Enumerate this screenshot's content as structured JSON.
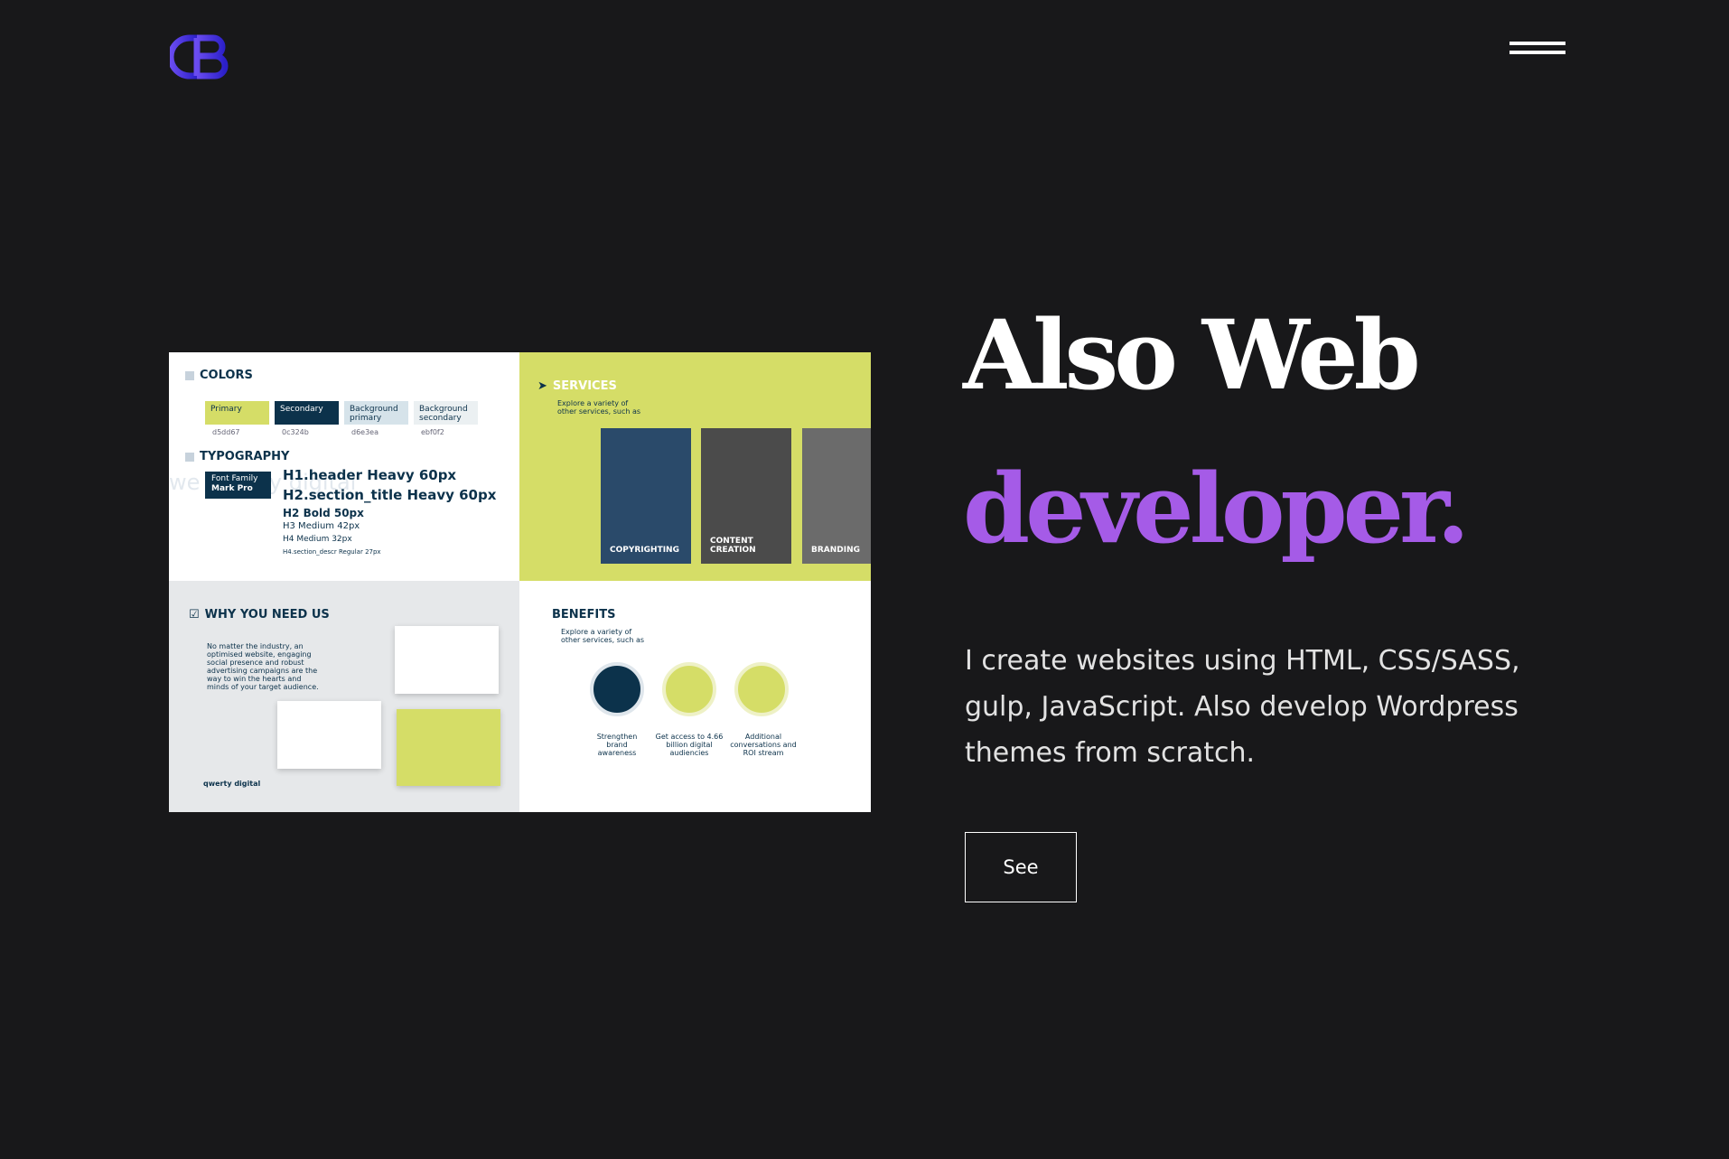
{
  "header": {
    "logo_icon": "cb-logo",
    "logo_color": "#5a3be0",
    "menu_icon": "hamburger-icon"
  },
  "hero": {
    "title_line1": "Also Web",
    "title_line2": "developer.",
    "title_line2_color": "#a55be7",
    "description": "I create websites using HTML, CSS/SASS, gulp, JavaScript. Also develop Wordpress themes from scratch.",
    "cta_label": "See"
  },
  "preview": {
    "colors": {
      "heading": "COLORS",
      "swatches": [
        {
          "label": "Primary",
          "hex": "d5dd67",
          "color": "#d5dd67"
        },
        {
          "label": "Secondary",
          "hex": "0c324b",
          "color": "#0c324b"
        },
        {
          "label": "Background primary",
          "hex": "d6e3ea",
          "color": "#d6e3ea"
        },
        {
          "label": "Background secondary",
          "hex": "ebf0f2",
          "color": "#ebf0f2"
        }
      ]
    },
    "typography": {
      "heading": "TYPOGRAPHY",
      "font_family_label": "Font Family",
      "font_family_name": "Mark Pro",
      "ghost_text": "we  qwerty digital",
      "lines": [
        {
          "text": "H1.header      Heavy    60px"
        },
        {
          "text": "H2.section_title  Heavy   60px"
        },
        {
          "text": "H2   Bold    50px"
        },
        {
          "text": "H3    Medium      42px"
        },
        {
          "text": "H4    Medium      32px"
        },
        {
          "text": "H4.section_descr     Regular      27px"
        }
      ]
    },
    "services": {
      "heading": "SERVICES",
      "subtext": "Explore a variety of other services, such as",
      "items": [
        "COPYRIGHTING",
        "CONTENT CREATION",
        "BRANDING"
      ]
    },
    "why": {
      "heading": "WHY YOU NEED US",
      "body": "No matter the industry, an optimised website, engaging social presence and robust advertising campaigns are the way to win the hearts and minds of your target audience.",
      "brand": "qwerty digital"
    },
    "benefits": {
      "heading": "BENEFITS",
      "subtext": "Explore a variety of other services, such as",
      "items": [
        "Strengthen brand awareness",
        "Get access to 4.66 billion digital audiencies",
        "Additional conversations and ROI stream"
      ]
    }
  }
}
